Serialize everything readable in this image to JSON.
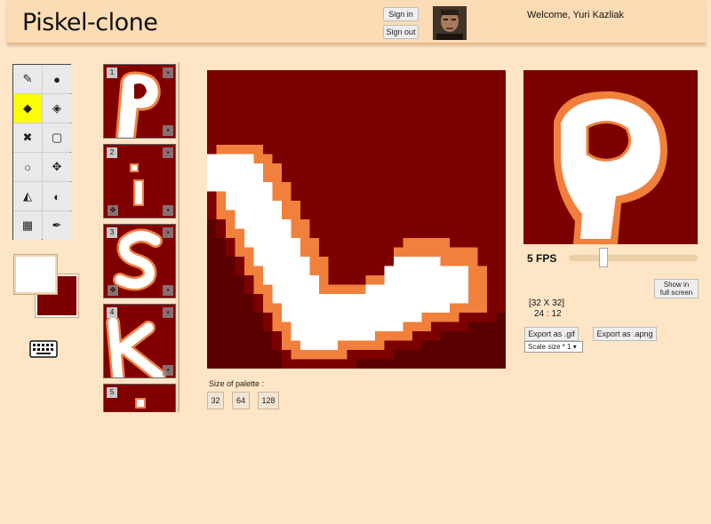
{
  "app": {
    "title": "Piskel-clone"
  },
  "auth": {
    "sign_in": "Sign in",
    "sign_out": "Sign out",
    "welcome": "Welcome, Yuri Kazliak"
  },
  "tools": [
    {
      "name": "pen-tool",
      "icon": "✎"
    },
    {
      "name": "vertical-mirror-tool",
      "icon": "●"
    },
    {
      "name": "paint-bucket-tool",
      "icon": "◆"
    },
    {
      "name": "paint-same-pixels-tool",
      "icon": "◈"
    },
    {
      "name": "eraser-tool",
      "icon": "✖"
    },
    {
      "name": "select-rect-tool",
      "icon": "▢"
    },
    {
      "name": "circle-tool",
      "icon": "○"
    },
    {
      "name": "move-tool",
      "icon": "✥"
    },
    {
      "name": "stroke-tool",
      "icon": "◭"
    },
    {
      "name": "lighten-tool",
      "icon": "◐"
    },
    {
      "name": "dithering-tool",
      "icon": "▦"
    },
    {
      "name": "color-picker-tool",
      "icon": "✒"
    }
  ],
  "colors": {
    "primary": "#ffffff",
    "secondary": "#7d0000",
    "accent": "#fbfc06"
  },
  "frames": [
    {
      "num": "1",
      "glyph": "P"
    },
    {
      "num": "2",
      "glyph": "i"
    },
    {
      "num": "3",
      "glyph": "S"
    },
    {
      "num": "4",
      "glyph": "K"
    },
    {
      "num": "5",
      "glyph": ""
    }
  ],
  "palette": {
    "label": "Size of palette :",
    "sizes": [
      "32",
      "64",
      "128"
    ]
  },
  "preview": {
    "fps_label": "5 FPS",
    "fps_value_fraction": 0.25,
    "fullscreen_label_line1": "Show in",
    "fullscreen_label_line2": "full screen",
    "size": "[32 X 32]",
    "coords": "24 : 12",
    "export_gif": "Export as .gif",
    "export_apng": "Export as .apng",
    "scale": "Scale size * 1"
  }
}
